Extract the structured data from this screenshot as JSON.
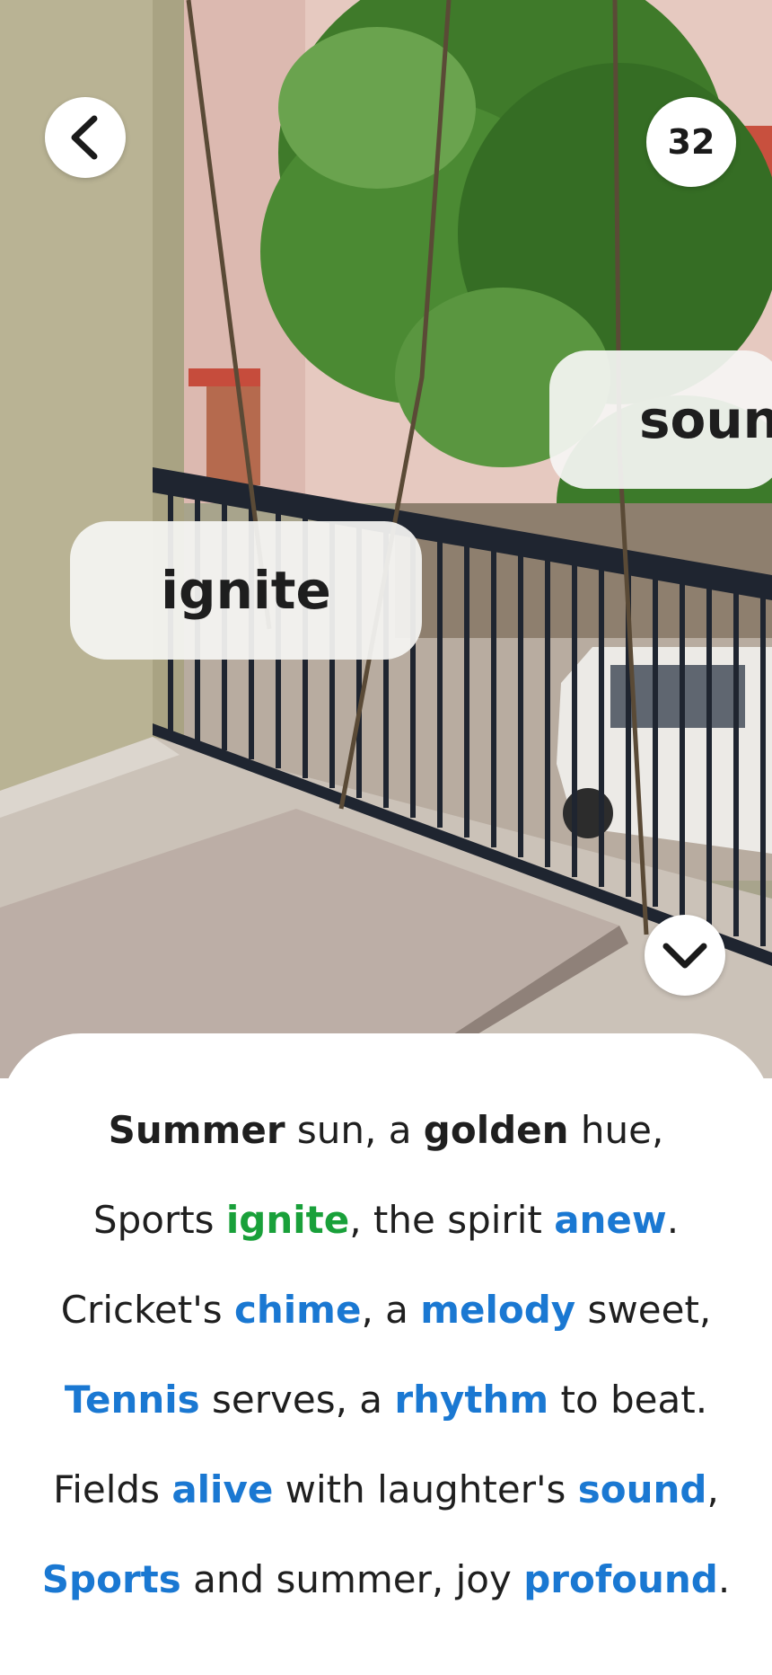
{
  "header": {
    "back_icon": "chevron-left-icon",
    "score": "32"
  },
  "bubbles": {
    "ignite": "ignite",
    "sound": "soun"
  },
  "collapse_icon": "chevron-down-icon",
  "poem": {
    "lines": [
      [
        {
          "text": "Summer",
          "style": "b"
        },
        {
          "text": " sun, a ",
          "style": ""
        },
        {
          "text": "golden",
          "style": "b"
        },
        {
          "text": " hue,",
          "style": ""
        }
      ],
      [
        {
          "text": "Sports ",
          "style": ""
        },
        {
          "text": "ignite",
          "style": "green"
        },
        {
          "text": ", the spirit ",
          "style": ""
        },
        {
          "text": "anew",
          "style": "blue"
        },
        {
          "text": ".",
          "style": ""
        }
      ],
      [
        {
          "text": "Cricket's ",
          "style": ""
        },
        {
          "text": "chime",
          "style": "blue"
        },
        {
          "text": ", a ",
          "style": ""
        },
        {
          "text": "melody",
          "style": "blue"
        },
        {
          "text": " sweet,",
          "style": ""
        }
      ],
      [
        {
          "text": "Tennis",
          "style": "blue"
        },
        {
          "text": " serves, a ",
          "style": ""
        },
        {
          "text": "rhythm",
          "style": "blue"
        },
        {
          "text": " to beat.",
          "style": ""
        }
      ],
      [
        {
          "text": "Fields ",
          "style": ""
        },
        {
          "text": "alive",
          "style": "blue"
        },
        {
          "text": " with laughter's ",
          "style": ""
        },
        {
          "text": "sound",
          "style": "blue"
        },
        {
          "text": ",",
          "style": ""
        }
      ],
      [
        {
          "text": "Sports",
          "style": "blue"
        },
        {
          "text": " and summer, joy ",
          "style": ""
        },
        {
          "text": "profound",
          "style": "blue"
        },
        {
          "text": ".",
          "style": ""
        }
      ]
    ]
  },
  "colors": {
    "found_word": "#19a03a",
    "target_word": "#1a78d2",
    "text": "#1f1f1f"
  }
}
